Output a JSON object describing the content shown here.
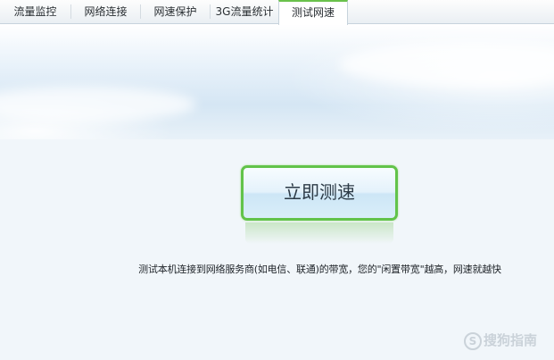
{
  "tabs": [
    {
      "label": "流量监控",
      "active": false
    },
    {
      "label": "网络连接",
      "active": false
    },
    {
      "label": "网速保护",
      "active": false
    },
    {
      "label": "3G流量统计",
      "active": false
    },
    {
      "label": "测试网速",
      "active": true
    }
  ],
  "main": {
    "speed_test_button": "立即测速",
    "description": "测试本机连接到网络服务商(如电信、联通)的带宽，您的\"闲置带宽\"越高，网速就越快"
  },
  "watermark": {
    "icon": "S",
    "text": "搜狗指南"
  },
  "colors": {
    "accent_green": "#62c34a",
    "active_tab_border": "#6ac14b"
  }
}
